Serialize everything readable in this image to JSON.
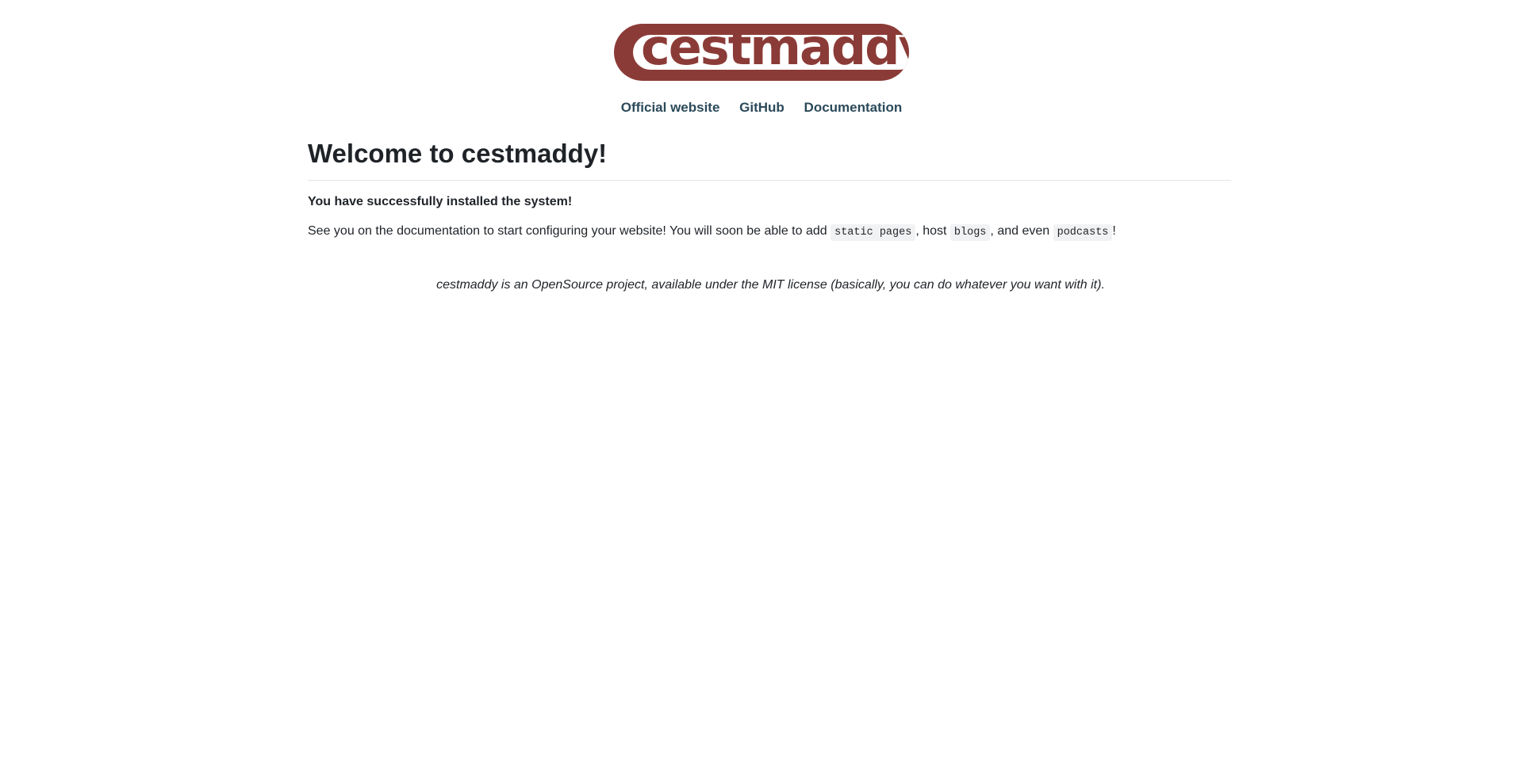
{
  "logo": {
    "text": "cestmaddy",
    "color": "#8b3b37"
  },
  "nav": {
    "items": [
      "Official website",
      "GitHub",
      "Documentation"
    ]
  },
  "main": {
    "title": "Welcome to cestmaddy!",
    "success_message": "You have successfully installed the system!",
    "info": {
      "text_before": "See you on the documentation to start configuring your website! You will soon be able to add ",
      "code_static_pages": "static pages",
      "text_host": ", host ",
      "code_blogs": "blogs",
      "text_even": ", and even ",
      "code_podcasts": "podcasts",
      "text_end": "!"
    }
  },
  "footer": {
    "note": "cestmaddy is an OpenSource project, available under the MIT license (basically, you can do whatever you want with it)."
  }
}
